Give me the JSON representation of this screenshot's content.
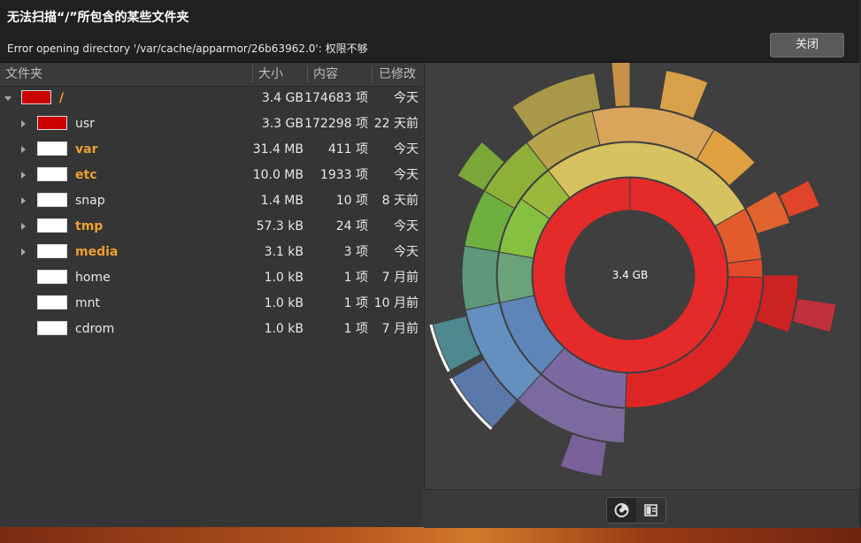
{
  "infobar": {
    "title": "无法扫描“/”所包含的某些文件夹",
    "message": "Error opening directory '/var/cache/apparmor/26b63962.0': 权限不够",
    "close_label": "关闭"
  },
  "tree": {
    "columns": {
      "folder": "文件夹",
      "size": "大小",
      "contents": "内容",
      "modified": "已修改"
    },
    "rows": [
      {
        "name": "/",
        "size": "3.4 GB",
        "items": "174683 项",
        "modified": "今天",
        "level": 0,
        "expander": "expanded",
        "swatch": "#cc0000",
        "highlight": true
      },
      {
        "name": "usr",
        "size": "3.3 GB",
        "items": "172298 项",
        "modified": "22 天前",
        "level": 1,
        "expander": "collapsed",
        "swatch": "#cc0000",
        "highlight": false
      },
      {
        "name": "var",
        "size": "31.4 MB",
        "items": "411 项",
        "modified": "今天",
        "level": 1,
        "expander": "collapsed",
        "swatch": "#ffffff",
        "highlight": true
      },
      {
        "name": "etc",
        "size": "10.0 MB",
        "items": "1933 项",
        "modified": "今天",
        "level": 1,
        "expander": "collapsed",
        "swatch": "#ffffff",
        "highlight": true
      },
      {
        "name": "snap",
        "size": "1.4 MB",
        "items": "10 项",
        "modified": "8 天前",
        "level": 1,
        "expander": "collapsed",
        "swatch": "#ffffff",
        "highlight": false
      },
      {
        "name": "tmp",
        "size": "57.3 kB",
        "items": "24 项",
        "modified": "今天",
        "level": 1,
        "expander": "collapsed",
        "swatch": "#ffffff",
        "highlight": true
      },
      {
        "name": "media",
        "size": "3.1 kB",
        "items": "3 项",
        "modified": "今天",
        "level": 1,
        "expander": "collapsed",
        "swatch": "#ffffff",
        "highlight": true
      },
      {
        "name": "home",
        "size": "1.0 kB",
        "items": "1 项",
        "modified": "7 月前",
        "level": 1,
        "expander": "none",
        "swatch": "#ffffff",
        "highlight": false
      },
      {
        "name": "mnt",
        "size": "1.0 kB",
        "items": "1 项",
        "modified": "10 月前",
        "level": 1,
        "expander": "none",
        "swatch": "#ffffff",
        "highlight": false
      },
      {
        "name": "cdrom",
        "size": "1.0 kB",
        "items": "1 项",
        "modified": "7 月前",
        "level": 1,
        "expander": "none",
        "swatch": "#ffffff",
        "highlight": false
      }
    ]
  },
  "chart": {
    "center_label": "3.4 GB",
    "view_modes": [
      {
        "name": "rings-chart",
        "icon": "rings-chart-icon",
        "active": true
      },
      {
        "name": "treemap-chart",
        "icon": "treemap-chart-icon",
        "active": false
      }
    ]
  },
  "colors": {
    "highlight_text": "#f0a030",
    "usr_red": "#e52a2a",
    "background": "#3f3f3f"
  }
}
